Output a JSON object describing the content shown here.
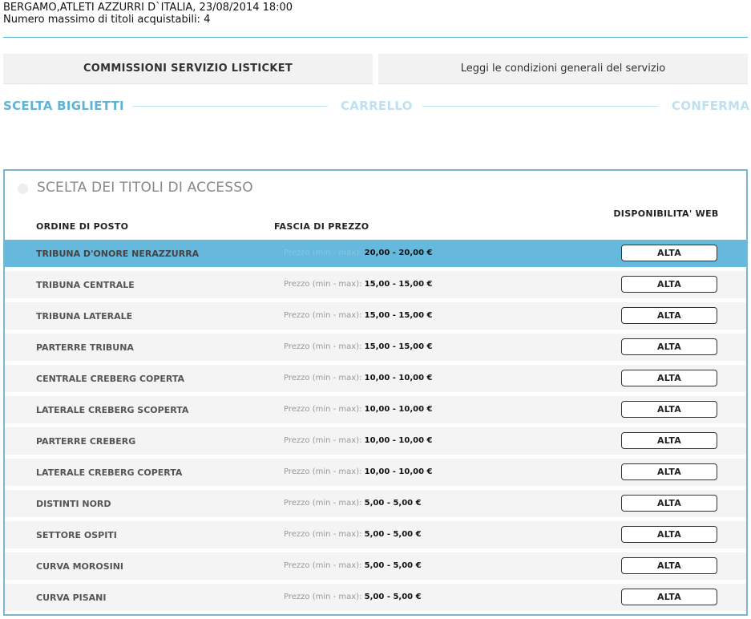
{
  "event": {
    "title": "BERGAMO,ATLETI AZZURRI D`ITALIA, 23/08/2014 18:00",
    "max_titles": "Numero massimo di titoli acquistabili: 4"
  },
  "buttons": {
    "commissioni": "COMMISSIONI SERVIZIO LISTICKET",
    "condizioni": "Leggi le condizioni generali del servizio"
  },
  "steps": {
    "step1": "SCELTA BIGLIETTI",
    "step2": "CARRELLO",
    "step3": "CONFERMA"
  },
  "panel": {
    "title": "SCELTA DEI TITOLI DI ACCESSO",
    "col_settore": "ORDINE DI POSTO",
    "col_prezzo": "FASCIA DI PREZZO",
    "col_disp": "DISPONIBILITA' WEB"
  },
  "price_label": "Prezzo (min - max):",
  "rows": [
    {
      "name": "TRIBUNA D'ONORE NERAZZURRA",
      "price": "20,00 - 20,00 €",
      "disp": "ALTA",
      "selected": true
    },
    {
      "name": "TRIBUNA CENTRALE",
      "price": "15,00 - 15,00 €",
      "disp": "ALTA"
    },
    {
      "name": "TRIBUNA LATERALE",
      "price": "15,00 - 15,00 €",
      "disp": "ALTA"
    },
    {
      "name": "PARTERRE TRIBUNA",
      "price": "15,00 - 15,00 €",
      "disp": "ALTA"
    },
    {
      "name": "CENTRALE CREBERG COPERTA",
      "price": "10,00 - 10,00 €",
      "disp": "ALTA"
    },
    {
      "name": "LATERALE CREBERG SCOPERTA",
      "price": "10,00 - 10,00 €",
      "disp": "ALTA"
    },
    {
      "name": "PARTERRE CREBERG",
      "price": "10,00 - 10,00 €",
      "disp": "ALTA"
    },
    {
      "name": "LATERALE CREBERG COPERTA",
      "price": "10,00 - 10,00 €",
      "disp": "ALTA"
    },
    {
      "name": "DISTINTI NORD",
      "price": "5,00 - 5,00 €",
      "disp": "ALTA"
    },
    {
      "name": "SETTORE OSPITI",
      "price": "5,00 - 5,00 €",
      "disp": "ALTA"
    },
    {
      "name": "CURVA MOROSINI",
      "price": "5,00 - 5,00 €",
      "disp": "ALTA"
    },
    {
      "name": "CURVA PISANI",
      "price": "5,00 - 5,00 €",
      "disp": "ALTA"
    }
  ],
  "colors": {
    "accent": "#5fb3d4",
    "selected_row": "#67b8dd",
    "panel_border": "#7bb7cc"
  }
}
